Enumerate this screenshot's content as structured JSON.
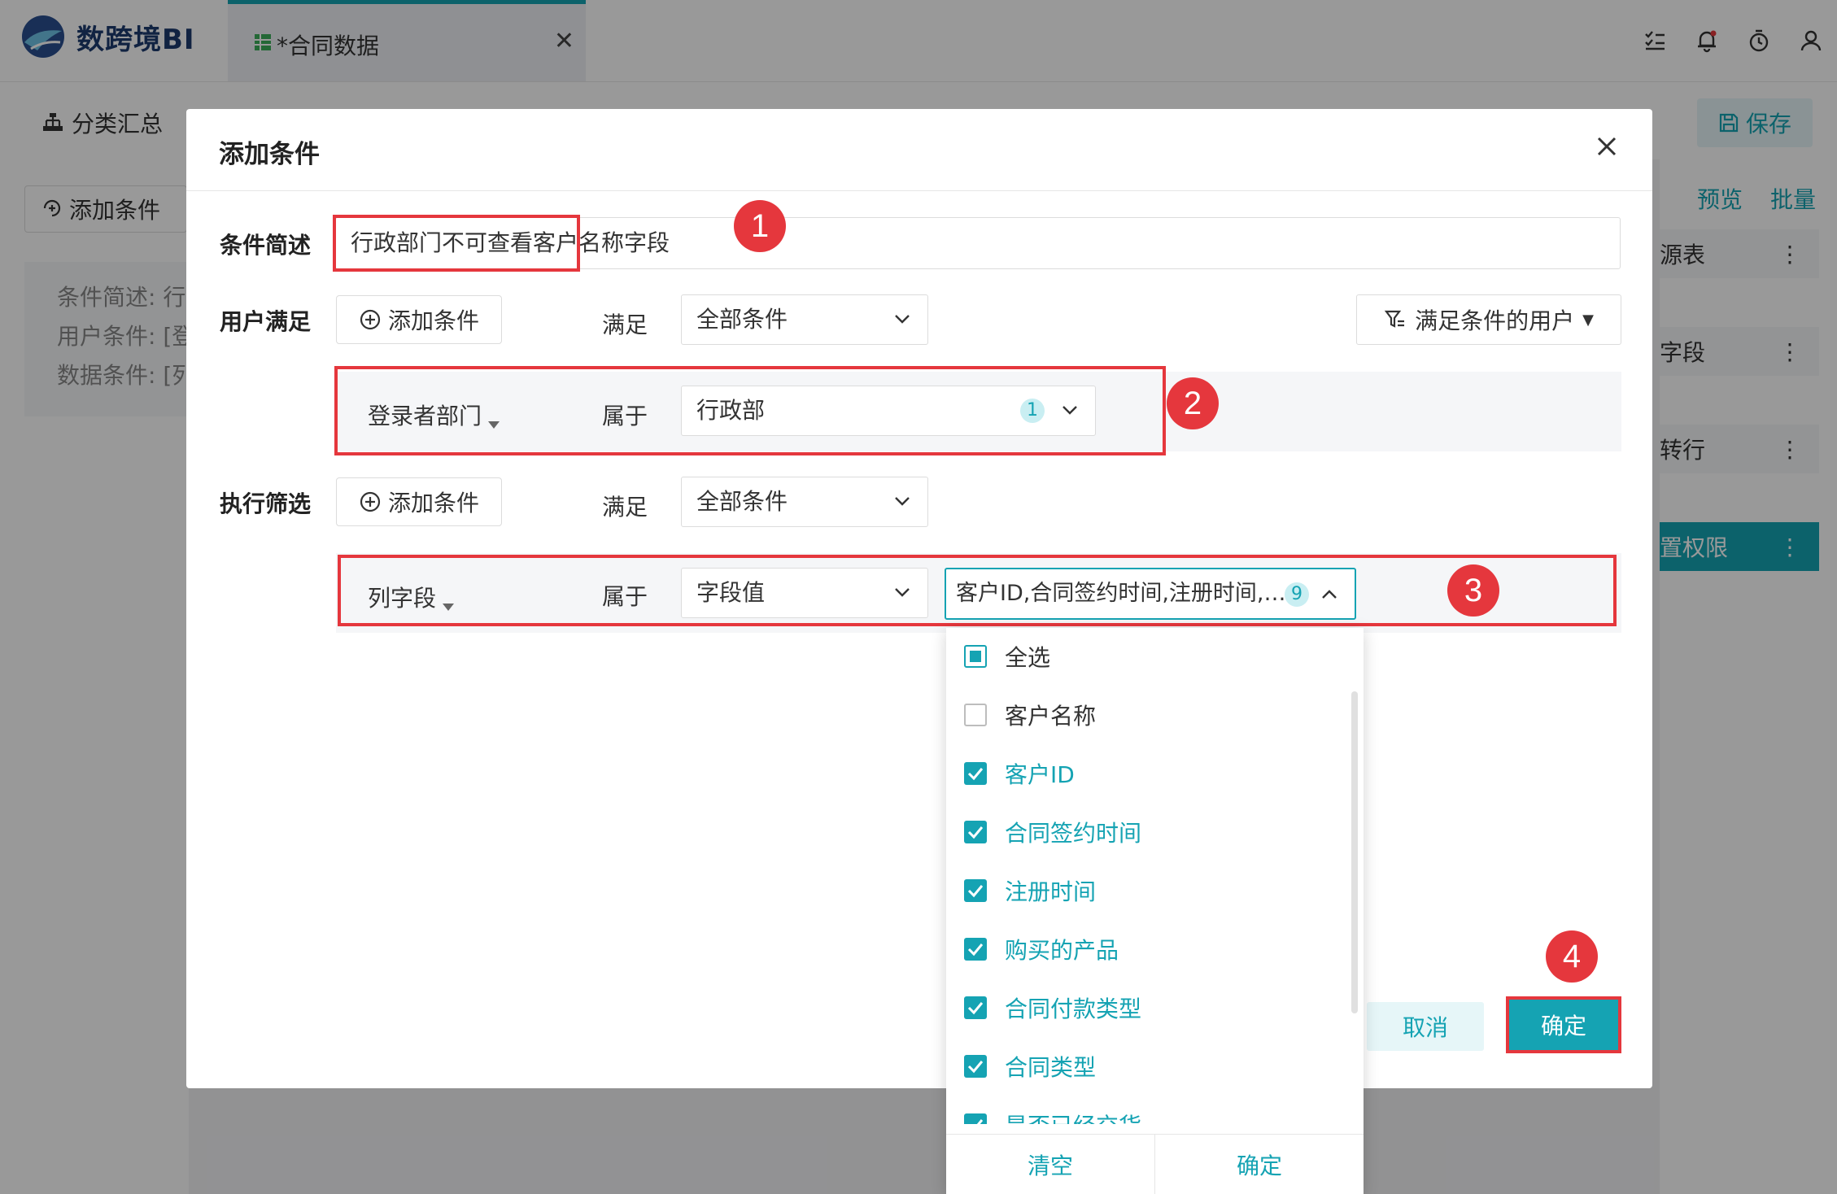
{
  "app": {
    "logo_text": "数跨境BI"
  },
  "tab": {
    "label": "*合同数据"
  },
  "toolbar": {
    "category": "分类汇总",
    "save": "保存"
  },
  "left_panel": {
    "add_condition": "添加条件",
    "summary_lines": [
      "条件简述: 行",
      "用户条件: [登",
      "数据条件: [列"
    ]
  },
  "right_panel": {
    "preview": "预览",
    "batch": "批量",
    "rows": [
      "源表",
      "字段",
      "转行",
      "置权限"
    ]
  },
  "modal": {
    "title": "添加条件",
    "desc_label": "条件简述",
    "desc_value": "行政部门不可查看客户名称字段",
    "user_label": "用户满足",
    "add_condition": "添加条件",
    "satisfy": "满足",
    "all_conditions": "全部条件",
    "users_button": "满足条件的用户",
    "user_field": "登录者部门",
    "belongs": "属于",
    "user_value": "行政部",
    "user_value_count": "1",
    "filter_label": "执行筛选",
    "filter_field": "列字段",
    "filter_type": "字段值",
    "filter_values": "客户ID,合同签约时间,注册时间,…",
    "filter_values_count": "9",
    "cancel": "取消",
    "confirm": "确定"
  },
  "dropdown": {
    "items": [
      {
        "label": "全选",
        "state": "partial"
      },
      {
        "label": "客户名称",
        "state": "off"
      },
      {
        "label": "客户ID",
        "state": "on"
      },
      {
        "label": "合同签约时间",
        "state": "on"
      },
      {
        "label": "注册时间",
        "state": "on"
      },
      {
        "label": "购买的产品",
        "state": "on"
      },
      {
        "label": "合同付款类型",
        "state": "on"
      },
      {
        "label": "合同类型",
        "state": "on"
      },
      {
        "label": "是否已经交货",
        "state": "on"
      }
    ],
    "clear": "清空",
    "confirm": "确定"
  },
  "steps": [
    "1",
    "2",
    "3",
    "4"
  ],
  "colors": {
    "accent": "#15a3b3",
    "highlight": "#e5373d"
  }
}
